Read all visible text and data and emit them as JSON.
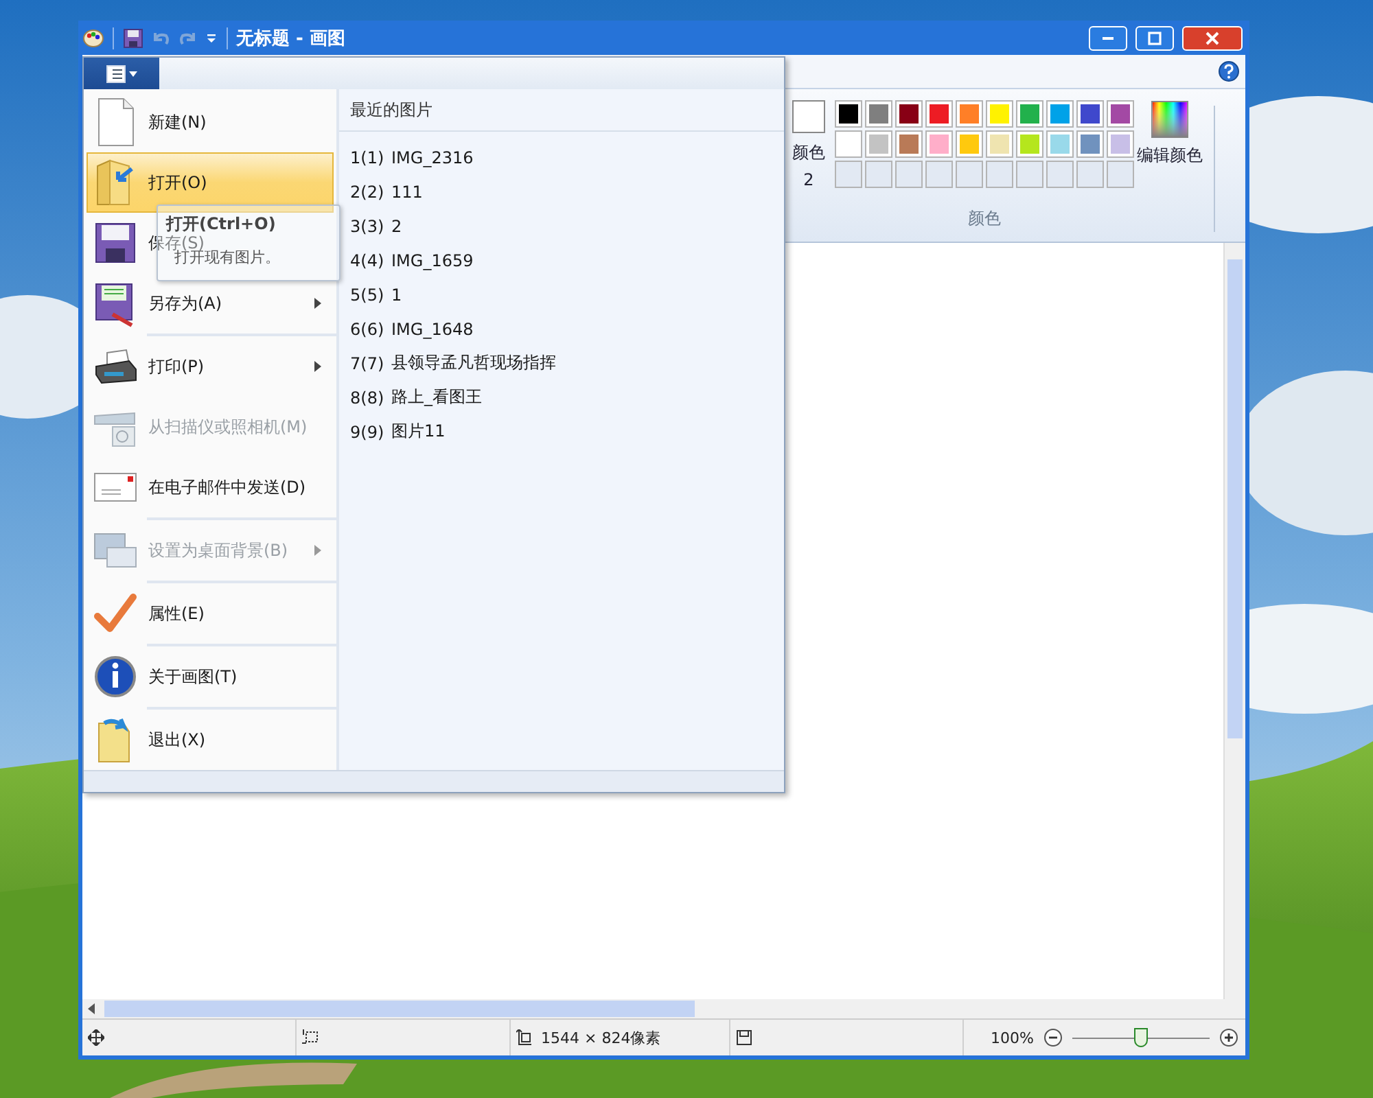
{
  "window": {
    "title": "无标题 - 画图"
  },
  "ribbon": {
    "color2": {
      "label": "颜色 2",
      "color": "#ffffff"
    },
    "palette": [
      {
        "color": "#000000"
      },
      {
        "color": "#7f7f7f"
      },
      {
        "color": "#880015"
      },
      {
        "color": "#ed1c24"
      },
      {
        "color": "#ff7f27"
      },
      {
        "color": "#fff200"
      },
      {
        "color": "#22b14c"
      },
      {
        "color": "#00a2e8"
      },
      {
        "color": "#3f48cc"
      },
      {
        "color": "#a349a4"
      },
      {
        "color": "#ffffff"
      },
      {
        "color": "#c3c3c3"
      },
      {
        "color": "#b97a57"
      },
      {
        "color": "#ffaec9"
      },
      {
        "color": "#ffc90e"
      },
      {
        "color": "#efe4b0"
      },
      {
        "color": "#b5e61d"
      },
      {
        "color": "#99d9ea"
      },
      {
        "color": "#7092be"
      },
      {
        "color": "#c8bfe7"
      }
    ],
    "edit_colors": "编辑颜色",
    "group_label": "颜色"
  },
  "file_menu": {
    "items": [
      {
        "kind": "new",
        "label": "新建(N)",
        "selected": false,
        "disabled": false,
        "has_submenu": false,
        "separator_above": false
      },
      {
        "kind": "open",
        "label": "打开(O)",
        "selected": true,
        "disabled": false,
        "has_submenu": false,
        "separator_above": false
      },
      {
        "kind": "save",
        "label": "保存(S)",
        "selected": false,
        "disabled": false,
        "has_submenu": false,
        "separator_above": false
      },
      {
        "kind": "saveas",
        "label": "另存为(A)",
        "selected": false,
        "disabled": false,
        "has_submenu": true,
        "separator_above": false
      },
      {
        "kind": "print",
        "label": "打印(P)",
        "selected": false,
        "disabled": false,
        "has_submenu": true,
        "separator_above": true
      },
      {
        "kind": "scanner",
        "label": "从扫描仪或照相机(M)",
        "selected": false,
        "disabled": true,
        "has_submenu": false,
        "separator_above": false
      },
      {
        "kind": "email",
        "label": "在电子邮件中发送(D)",
        "selected": false,
        "disabled": false,
        "has_submenu": false,
        "separator_above": false
      },
      {
        "kind": "desktop",
        "label": "设置为桌面背景(B)",
        "selected": false,
        "disabled": true,
        "has_submenu": true,
        "separator_above": true
      },
      {
        "kind": "properties",
        "label": "属性(E)",
        "selected": false,
        "disabled": false,
        "has_submenu": false,
        "separator_above": true
      },
      {
        "kind": "about",
        "label": "关于画图(T)",
        "selected": false,
        "disabled": false,
        "has_submenu": false,
        "separator_above": true
      },
      {
        "kind": "exit",
        "label": "退出(X)",
        "selected": false,
        "disabled": false,
        "has_submenu": false,
        "separator_above": true
      }
    ],
    "recent_title": "最近的图片",
    "recent": [
      {
        "number": "1(1)",
        "name": "IMG_2316"
      },
      {
        "number": "2(2)",
        "name": "111"
      },
      {
        "number": "3(3)",
        "name": "2"
      },
      {
        "number": "4(4)",
        "name": "IMG_1659"
      },
      {
        "number": "5(5)",
        "name": "1"
      },
      {
        "number": "6(6)",
        "name": "IMG_1648"
      },
      {
        "number": "7(7)",
        "name": "县领导孟凡哲现场指挥"
      },
      {
        "number": "8(8)",
        "name": "路上_看图王"
      },
      {
        "number": "9(9)",
        "name": "图片11"
      }
    ],
    "tooltip": {
      "title": "打开(Ctrl+O)",
      "description": "打开现有图片。"
    }
  },
  "status_bar": {
    "size": "1544 × 824像素",
    "zoom": "100%",
    "zoom_level": {
      "level": 0.5
    }
  }
}
